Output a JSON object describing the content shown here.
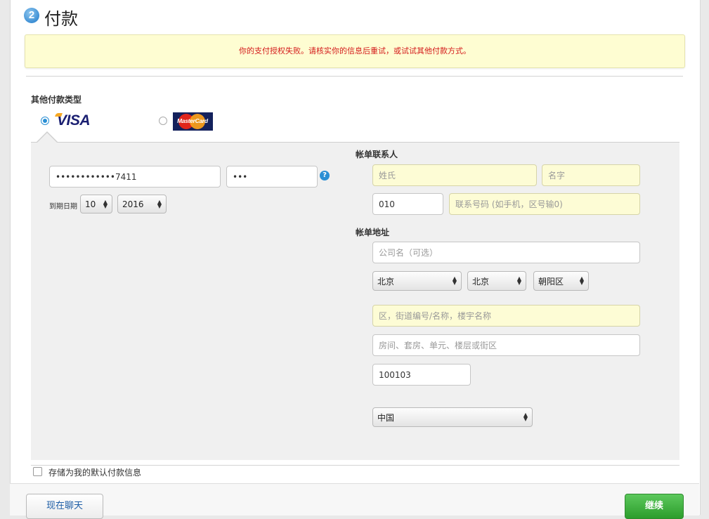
{
  "step": {
    "number": "2",
    "title": "付款"
  },
  "alert": {
    "message": "你的支付授权失败。请核实你的信息后重试，或试试其他付款方式。"
  },
  "payment_types": {
    "label": "其他付款类型",
    "visa_text": "VISA",
    "mastercard_text": "MasterCard",
    "selected": "visa"
  },
  "card": {
    "number_value": "••••••••••••7411",
    "cvv_value": "•••",
    "help_glyph": "?",
    "expiry_label": "到期日期",
    "expiry_month": "10",
    "expiry_year": "2016"
  },
  "contact": {
    "heading": "帐单联系人",
    "last_name_placeholder": "姓氏",
    "first_name_placeholder": "名字",
    "area_code_value": "010",
    "phone_placeholder": "联系号码 (如手机，区号输0)"
  },
  "address": {
    "heading": "帐单地址",
    "company_placeholder": "公司名（可选）",
    "province": "北京",
    "city": "北京",
    "district": "朝阳区",
    "street_placeholder": "区，街道编号/名称，楼宇名称",
    "unit_placeholder": "房间、套房、单元、楼层或街区",
    "postal_code": "100103",
    "country": "中国"
  },
  "save_default": {
    "label": "存储为我的默认付款信息",
    "checked": false
  },
  "buttons": {
    "chat": "现在聊天",
    "continue": "继续"
  },
  "colors": {
    "alert_text": "#d41b1b",
    "accent": "#2a8fd4",
    "continue_green": "#2c9d2c"
  }
}
